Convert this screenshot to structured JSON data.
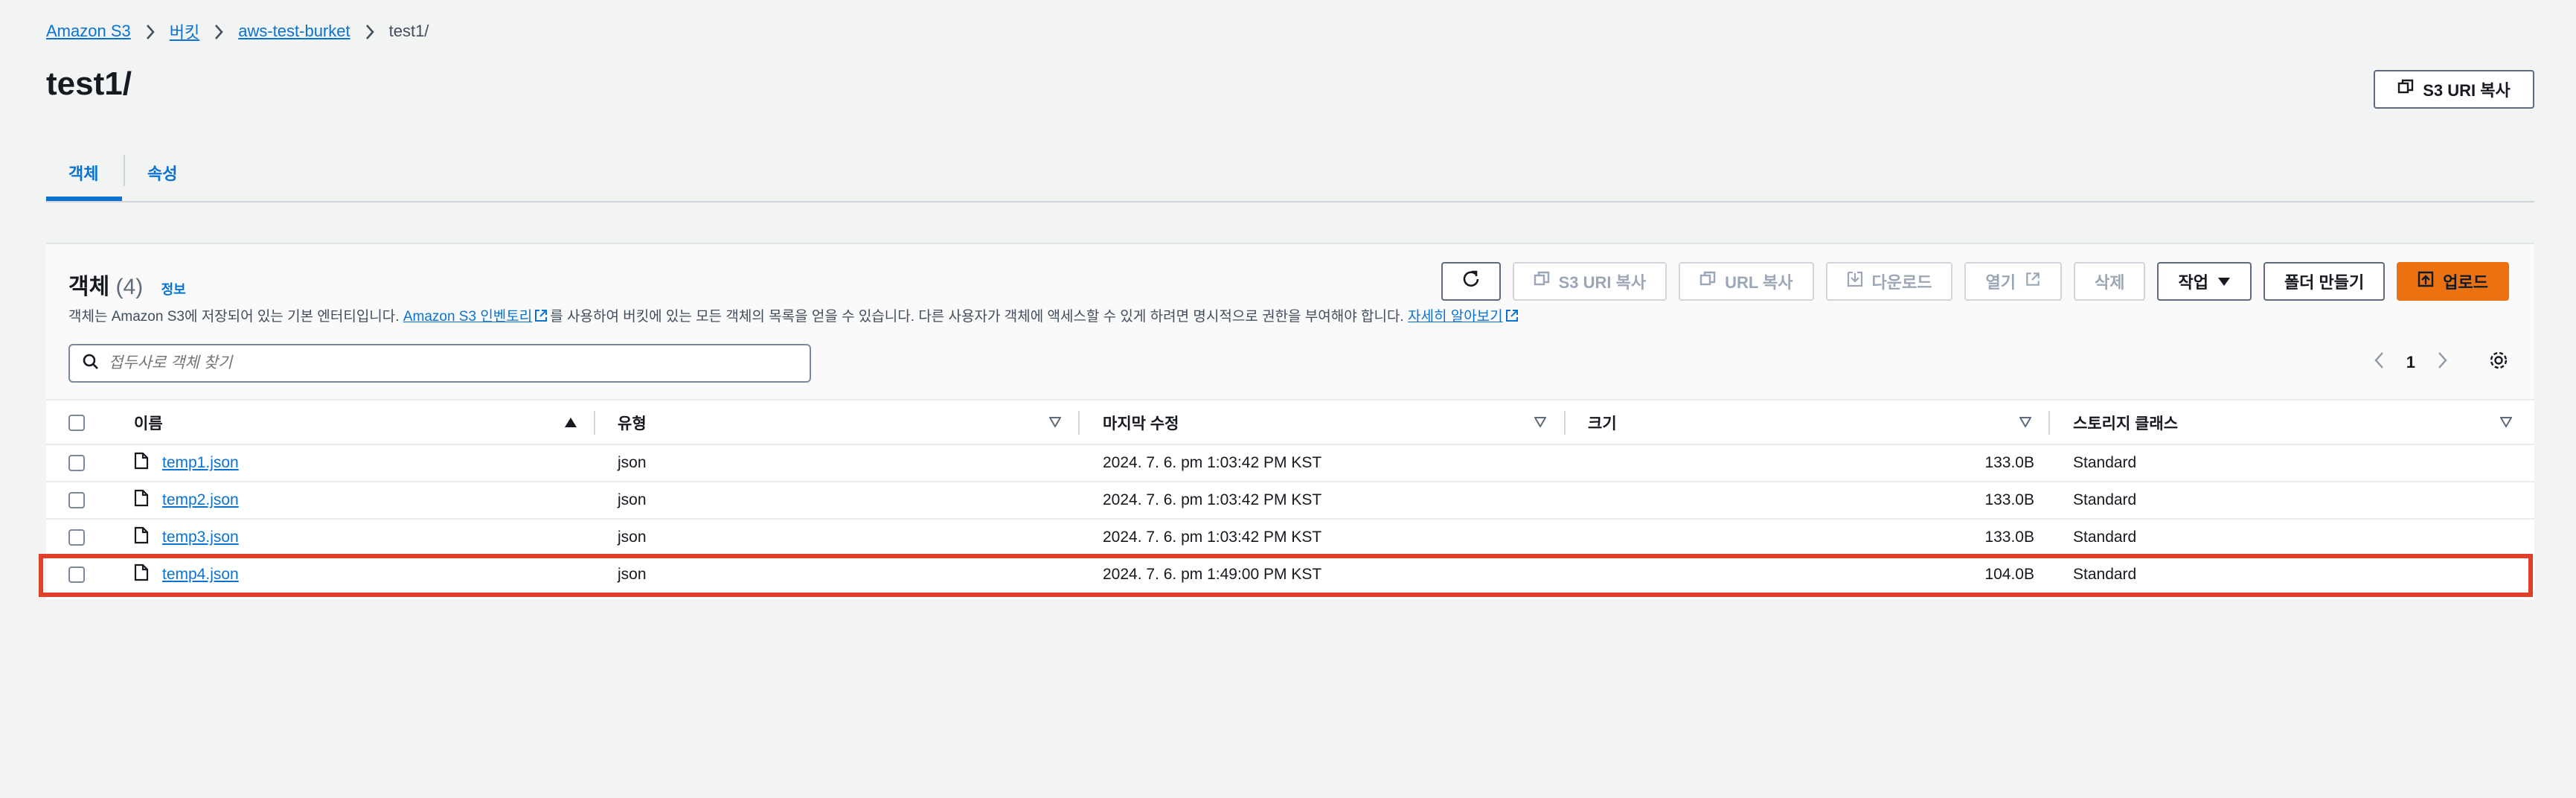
{
  "breadcrumb": {
    "items": [
      "Amazon S3",
      "버킷",
      "aws-test-burket",
      "test1/"
    ]
  },
  "page": {
    "title": "test1/",
    "copy_uri_label": "S3 URI 복사"
  },
  "tabs": [
    {
      "label": "객체",
      "active": true
    },
    {
      "label": "속성",
      "active": false
    }
  ],
  "objects_panel": {
    "title": "객체",
    "count": "(4)",
    "info": "정보",
    "description": {
      "before": "객체는 Amazon S3에 저장되어 있는 기본 엔터티입니다.",
      "inventory_link": "Amazon S3 인벤토리",
      "middle": "를 사용하여 버킷에 있는 모든 객체의 목록을 얻을 수 있습니다. 다른 사용자가 객체에 액세스할 수 있게 하려면 명시적으로 권한을 부여해야 합니다.",
      "learn_more_link": "자세히 알아보기"
    },
    "actions": {
      "copy_s3_uri": "S3 URI 복사",
      "copy_url": "URL 복사",
      "download": "다운로드",
      "open": "열기",
      "delete": "삭제",
      "actions_menu": "작업",
      "create_folder": "폴더 만들기",
      "upload": "업로드"
    },
    "search": {
      "placeholder": "접두사로 객체 찾기"
    },
    "pagination": {
      "current_page": "1"
    },
    "columns": [
      "이름",
      "유형",
      "마지막 수정",
      "크기",
      "스토리지 클래스"
    ],
    "rows": [
      {
        "name": "temp1.json",
        "type": "json",
        "modified": "2024. 7. 6. pm 1:03:42 PM KST",
        "size": "133.0B",
        "storage": "Standard"
      },
      {
        "name": "temp2.json",
        "type": "json",
        "modified": "2024. 7. 6. pm 1:03:42 PM KST",
        "size": "133.0B",
        "storage": "Standard"
      },
      {
        "name": "temp3.json",
        "type": "json",
        "modified": "2024. 7. 6. pm 1:03:42 PM KST",
        "size": "133.0B",
        "storage": "Standard"
      },
      {
        "name": "temp4.json",
        "type": "json",
        "modified": "2024. 7. 6. pm 1:49:00 PM KST",
        "size": "104.0B",
        "storage": "Standard"
      }
    ]
  },
  "colors": {
    "link": "#0972d3",
    "primary": "#ec7211",
    "highlight": "#e0402a",
    "background": "#f2f3f3"
  }
}
